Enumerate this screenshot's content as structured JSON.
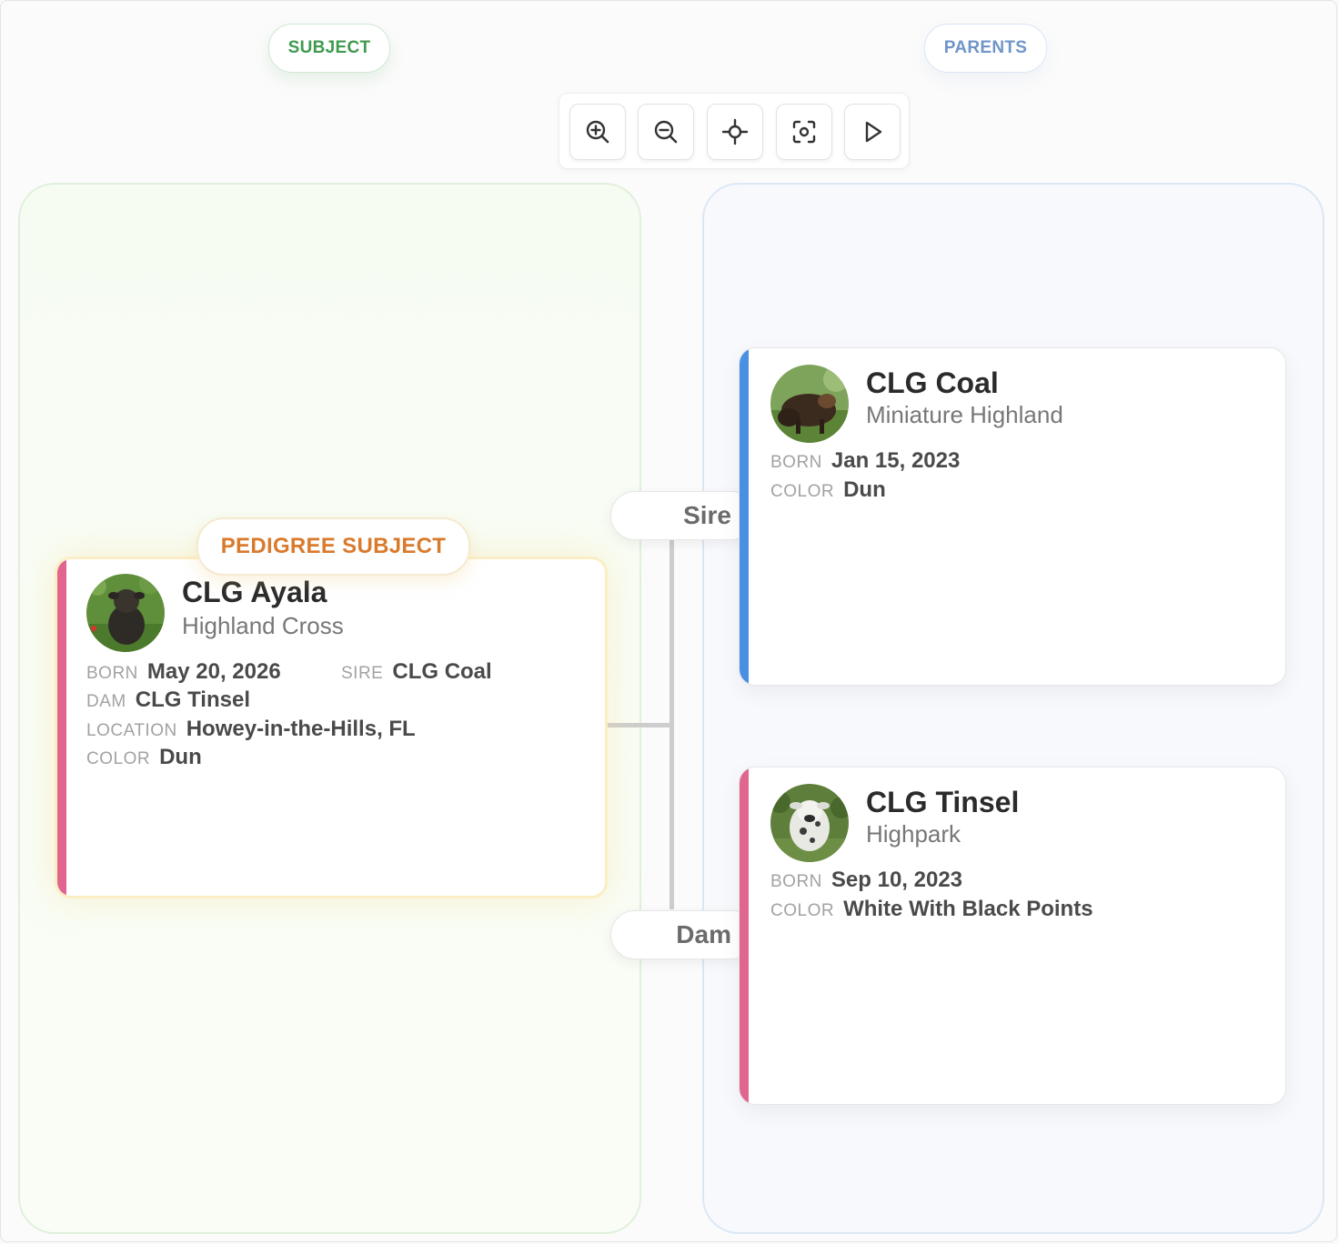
{
  "columns": {
    "subject_label": "SUBJECT",
    "parents_label": "PARENTS"
  },
  "toolbar": {
    "zoom_in": "zoom-in-icon",
    "zoom_out": "zoom-out-icon",
    "center": "crosshair-icon",
    "fit": "fit-screen-icon",
    "play": "play-icon"
  },
  "subject": {
    "badge": "PEDIGREE SUBJECT",
    "name": "CLG Ayala",
    "breed": "Highland Cross",
    "born_label": "BORN",
    "born": "May 20, 2026",
    "sire_label": "SIRE",
    "sire": "CLG Coal",
    "dam_label": "DAM",
    "dam": "CLG Tinsel",
    "location_label": "LOCATION",
    "location": "Howey-in-the-Hills, FL",
    "color_label": "COLOR",
    "color": "Dun",
    "accent": "#e0668f"
  },
  "relations": {
    "sire_label": "Sire",
    "dam_label": "Dam"
  },
  "sire": {
    "name": "CLG Coal",
    "breed": "Miniature Highland",
    "born_label": "BORN",
    "born": "Jan 15, 2023",
    "color_label": "COLOR",
    "color": "Dun",
    "accent": "#4a90e2"
  },
  "dam": {
    "name": "CLG Tinsel",
    "breed": "Highpark",
    "born_label": "BORN",
    "born": "Sep 10, 2023",
    "color_label": "COLOR",
    "color": "White With Black Points",
    "accent": "#e0668f"
  }
}
